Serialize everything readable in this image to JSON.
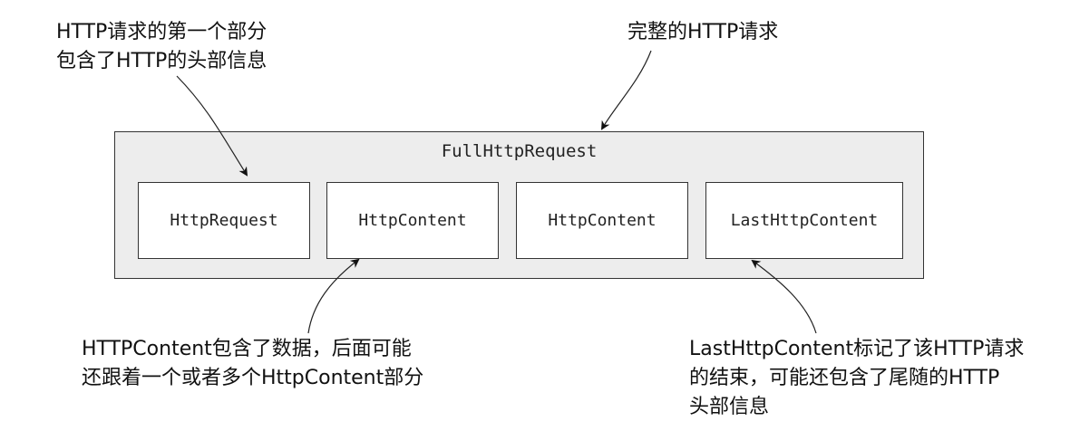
{
  "annotations": {
    "first_part": [
      "HTTP请求的第一个部分",
      "包含了HTTP的头部信息"
    ],
    "full_request": [
      "完整的HTTP请求"
    ],
    "content": [
      "HTTPContent包含了数据，后面可能",
      "还跟着一个或者多个HttpContent部分"
    ],
    "last_content": [
      "LastHttpContent标记了该HTTP请求",
      "的结束，可能还包含了尾随的HTTP",
      "头部信息"
    ]
  },
  "container": {
    "title": "FullHttpRequest",
    "parts": [
      "HttpRequest",
      "HttpContent",
      "HttpContent",
      "LastHttpContent"
    ]
  }
}
